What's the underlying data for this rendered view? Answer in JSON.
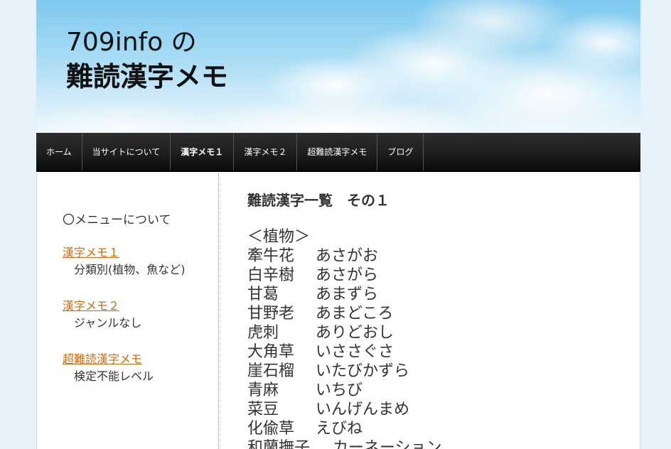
{
  "header": {
    "title_line1": "709info の",
    "title_line2": "難読漢字メモ"
  },
  "nav": {
    "items": [
      {
        "label": "ホーム"
      },
      {
        "label": "当サイトについて"
      },
      {
        "label": "漢字メモ１"
      },
      {
        "label": "漢字メモ２"
      },
      {
        "label": "超難読漢字メモ"
      },
      {
        "label": "ブログ"
      }
    ]
  },
  "sidebar": {
    "heading": "〇メニューについて",
    "links": [
      {
        "label": "漢字メモ１",
        "desc": "分類別(植物、魚など)"
      },
      {
        "label": "漢字メモ２",
        "desc": "ジャンルなし"
      },
      {
        "label": "超難読漢字メモ ",
        "desc": "検定不能レベル"
      }
    ]
  },
  "main": {
    "title": "難読漢字一覧　その１",
    "category": "＜植物＞",
    "entries": [
      {
        "word": "牽牛花",
        "reading": "あさがお"
      },
      {
        "word": "白辛樹",
        "reading": "あさがら"
      },
      {
        "word": "甘葛",
        "reading": "あまずら"
      },
      {
        "word": "甘野老",
        "reading": "あまどころ"
      },
      {
        "word": "虎刺",
        "reading": "ありどおし"
      },
      {
        "word": "大角草",
        "reading": "いささぐさ"
      },
      {
        "word": "崖石榴",
        "reading": "いたびかずら"
      },
      {
        "word": "青麻",
        "reading": "いちび"
      },
      {
        "word": "菜豆",
        "reading": "いんげんまめ"
      },
      {
        "word": "化偸草",
        "reading": "えびね"
      },
      {
        "word": "和蘭撫子",
        "reading": "カーネーション"
      }
    ]
  }
}
